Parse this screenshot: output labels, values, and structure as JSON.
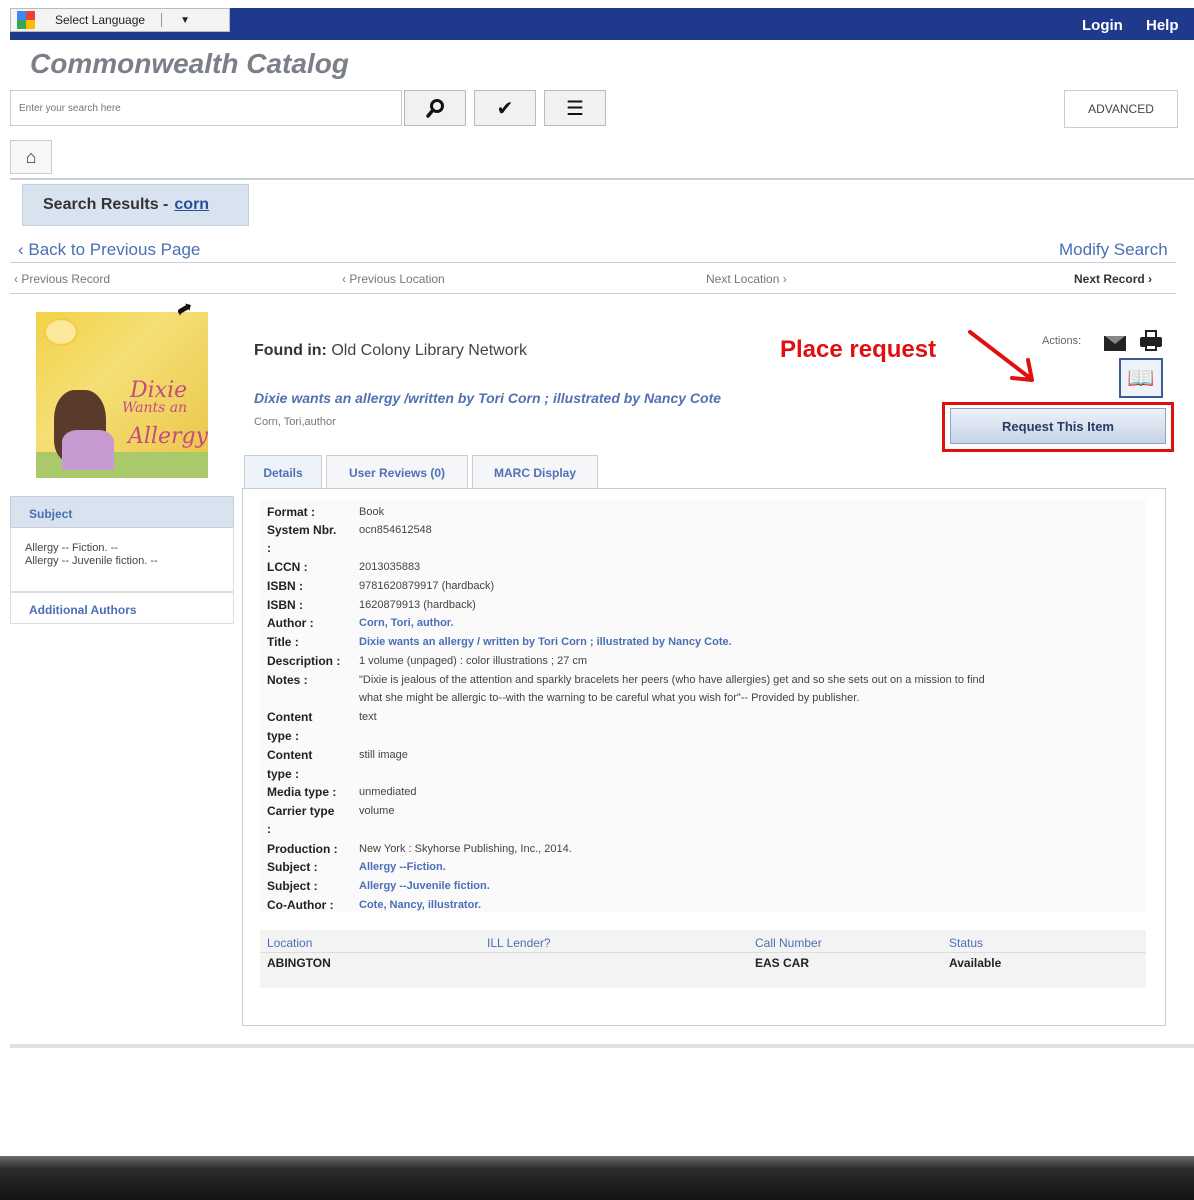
{
  "header": {
    "language_label": "Select Language",
    "login": "Login",
    "help": "Help",
    "catalog_title": "Commonwealth Catalog"
  },
  "search": {
    "placeholder": "Enter your search here",
    "advanced": "ADVANCED"
  },
  "results_tab": {
    "label": "Search Results - ",
    "query": "corn"
  },
  "nav": {
    "back": "‹ Back to Previous Page",
    "modify": "Modify Search",
    "prev_record": "‹ Previous Record",
    "prev_location": "‹ Previous Location",
    "next_location": "Next Location ›",
    "next_record": "Next Record ›"
  },
  "cover": {
    "title_line1": "Dixie",
    "title_line2": "Wants an",
    "title_line3": "Allergy"
  },
  "sidebar": {
    "subject_heading": "Subject",
    "subjects": [
      "Allergy -- Fiction. --",
      "Allergy -- Juvenile fiction. --"
    ],
    "additional_authors": "Additional Authors"
  },
  "record": {
    "found_in_label": "Found in:",
    "found_in_value": "Old Colony Library Network",
    "title": "Dixie wants an allergy /written by Tori Corn ; illustrated by Nancy Cote",
    "author_line": "Corn, Tori,author"
  },
  "actions": {
    "label": "Actions:",
    "request_button": "Request This Item"
  },
  "annotation": {
    "text": "Place request"
  },
  "tabs": [
    "Details",
    "User Reviews (0)",
    "MARC Display"
  ],
  "details": {
    "format_label": "Format :",
    "format": "Book",
    "sysnbr_label": "System Nbr.",
    "sysnbr_colon": ":",
    "sysnbr": "ocn854612548",
    "lccn_label": "LCCN :",
    "lccn": "2013035883",
    "isbn_label": "ISBN :",
    "isbn1": "9781620879917 (hardback)",
    "isbn2": "1620879913 (hardback)",
    "author_label": "Author :",
    "author": "Corn, Tori, author.",
    "title_label": "Title :",
    "title": "Dixie wants an allergy / written by Tori Corn ; illustrated by Nancy Cote.",
    "description_label": "Description :",
    "description": "1 volume (unpaged) : color illustrations ; 27 cm",
    "notes_label": "Notes :",
    "notes_line1": "\"Dixie is jealous of the attention and sparkly bracelets her peers (who have allergies) get and so she sets out on a mission to find",
    "notes_line2": "what she might be allergic to--with the warning to be careful what you wish for\"-- Provided by publisher.",
    "content_type_label1": "Content",
    "content_type_label2": "type :",
    "content_type1": "text",
    "content_type2": "still image",
    "media_type_label": "Media type :",
    "media_type": "unmediated",
    "carrier_type_label": "Carrier type",
    "carrier_colon": ":",
    "carrier_type": "volume",
    "production_label": "Production :",
    "production": "New York : Skyhorse Publishing, Inc., 2014.",
    "subject_label": "Subject :",
    "subject1": "Allergy --Fiction.",
    "subject2": "Allergy --Juvenile fiction.",
    "coauthor_label": "Co-Author :",
    "coauthor": "Cote, Nancy, illustrator."
  },
  "holdings": {
    "headers": [
      "Location",
      "ILL Lender?",
      "Call Number",
      "Status"
    ],
    "row": [
      "ABINGTON",
      "",
      "EAS CAR",
      "Available"
    ]
  },
  "colors": {
    "topbar": "#1f3a8c",
    "link": "#4a6fb5",
    "annotation_red": "#e01010"
  }
}
